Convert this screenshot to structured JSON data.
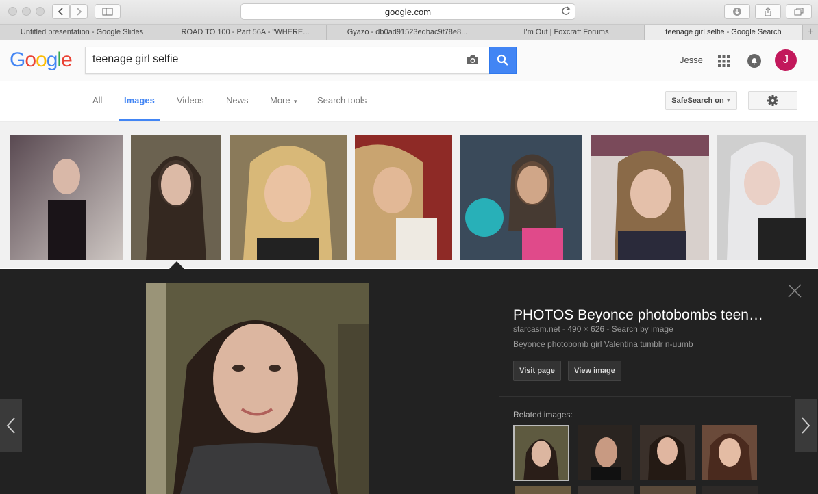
{
  "browser": {
    "url": "google.com",
    "tabs": [
      {
        "label": "Untitled presentation - Google Slides"
      },
      {
        "label": "ROAD TO 100 - Part 56A - \"WHERE..."
      },
      {
        "label": "Gyazo - db0ad91523edbac9f78e8..."
      },
      {
        "label": "I'm Out | Foxcraft Forums"
      },
      {
        "label": "teenage girl selfie - Google Search"
      }
    ]
  },
  "header": {
    "logo_letters": [
      "G",
      "o",
      "o",
      "g",
      "l",
      "e"
    ],
    "logo_colors": [
      "#4285f4",
      "#ea4335",
      "#fbbc05",
      "#4285f4",
      "#34a853",
      "#ea4335"
    ],
    "search_value": "teenage girl selfie",
    "user_name": "Jesse",
    "avatar_letter": "J"
  },
  "nav": {
    "items": [
      {
        "label": "All"
      },
      {
        "label": "Images"
      },
      {
        "label": "Videos"
      },
      {
        "label": "News"
      },
      {
        "label": "More"
      },
      {
        "label": "Search tools"
      }
    ],
    "safesearch_label": "SafeSearch on"
  },
  "preview": {
    "title": "PHOTOS Beyonce photobombs teen…",
    "meta": "starcasm.net - 490 × 626 - Search by image",
    "description": "Beyonce photobomb girl Valentina tumblr n-uumb",
    "visit_label": "Visit page",
    "view_label": "View image",
    "related_label": "Related images:"
  },
  "colors": {
    "accent": "#4285f4",
    "panel_bg": "#222222",
    "avatar_bg": "#c2185b"
  }
}
